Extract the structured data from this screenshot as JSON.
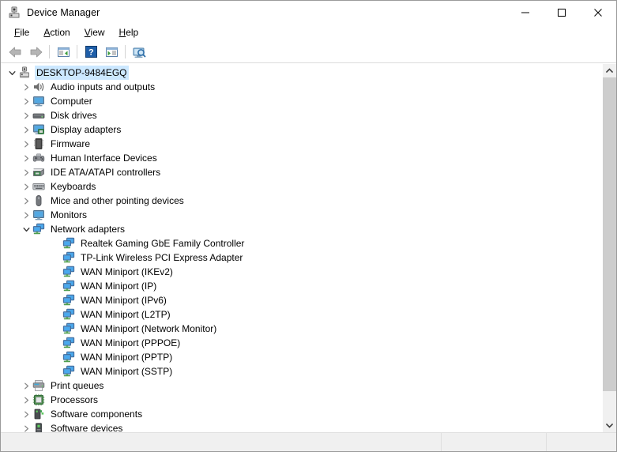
{
  "window": {
    "title": "Device Manager",
    "app_icon": "device-manager-icon",
    "controls": {
      "minimize": "minimize-icon",
      "maximize": "maximize-icon",
      "close": "close-icon"
    }
  },
  "menubar": {
    "items": [
      {
        "label": "File",
        "accel": "F"
      },
      {
        "label": "Action",
        "accel": "A"
      },
      {
        "label": "View",
        "accel": "V"
      },
      {
        "label": "Help",
        "accel": "H"
      }
    ]
  },
  "toolbar": {
    "buttons": [
      {
        "name": "back-button",
        "icon": "back-arrow-icon"
      },
      {
        "name": "forward-button",
        "icon": "forward-arrow-icon"
      },
      {
        "name": "separator-1",
        "icon": "separator"
      },
      {
        "name": "properties-button",
        "icon": "properties-panel-icon"
      },
      {
        "name": "separator-2",
        "icon": "separator"
      },
      {
        "name": "help-button",
        "icon": "help-question-icon"
      },
      {
        "name": "update-driver-button",
        "icon": "update-panel-icon"
      },
      {
        "name": "separator-3",
        "icon": "separator"
      },
      {
        "name": "scan-hardware-button",
        "icon": "scan-monitor-icon"
      }
    ]
  },
  "tree": {
    "root": {
      "label": "DESKTOP-9484EGQ",
      "icon": "computer-root-icon",
      "expanded": true,
      "selected": true
    },
    "nodes": [
      {
        "label": "Audio inputs and outputs",
        "icon": "speaker-icon",
        "level": 1,
        "expanded": false,
        "has_children": true
      },
      {
        "label": "Computer",
        "icon": "monitor-icon",
        "level": 1,
        "expanded": false,
        "has_children": true
      },
      {
        "label": "Disk drives",
        "icon": "disk-drive-icon",
        "level": 1,
        "expanded": false,
        "has_children": true
      },
      {
        "label": "Display adapters",
        "icon": "display-adapter-icon",
        "level": 1,
        "expanded": false,
        "has_children": true
      },
      {
        "label": "Firmware",
        "icon": "firmware-chip-icon",
        "level": 1,
        "expanded": false,
        "has_children": true
      },
      {
        "label": "Human Interface Devices",
        "icon": "gamepad-icon",
        "level": 1,
        "expanded": false,
        "has_children": true
      },
      {
        "label": "IDE ATA/ATAPI controllers",
        "icon": "ide-controller-icon",
        "level": 1,
        "expanded": false,
        "has_children": true
      },
      {
        "label": "Keyboards",
        "icon": "keyboard-icon",
        "level": 1,
        "expanded": false,
        "has_children": true
      },
      {
        "label": "Mice and other pointing devices",
        "icon": "mouse-icon",
        "level": 1,
        "expanded": false,
        "has_children": true
      },
      {
        "label": "Monitors",
        "icon": "monitor-icon",
        "level": 1,
        "expanded": false,
        "has_children": true
      },
      {
        "label": "Network adapters",
        "icon": "network-adapter-icon",
        "level": 1,
        "expanded": true,
        "has_children": true
      },
      {
        "label": "Realtek Gaming GbE Family Controller",
        "icon": "network-adapter-icon",
        "level": 2,
        "expanded": false,
        "has_children": false
      },
      {
        "label": "TP-Link Wireless PCI Express Adapter",
        "icon": "network-adapter-icon",
        "level": 2,
        "expanded": false,
        "has_children": false
      },
      {
        "label": "WAN Miniport (IKEv2)",
        "icon": "network-adapter-icon",
        "level": 2,
        "expanded": false,
        "has_children": false
      },
      {
        "label": "WAN Miniport (IP)",
        "icon": "network-adapter-icon",
        "level": 2,
        "expanded": false,
        "has_children": false
      },
      {
        "label": "WAN Miniport (IPv6)",
        "icon": "network-adapter-icon",
        "level": 2,
        "expanded": false,
        "has_children": false
      },
      {
        "label": "WAN Miniport (L2TP)",
        "icon": "network-adapter-icon",
        "level": 2,
        "expanded": false,
        "has_children": false
      },
      {
        "label": "WAN Miniport (Network Monitor)",
        "icon": "network-adapter-icon",
        "level": 2,
        "expanded": false,
        "has_children": false
      },
      {
        "label": "WAN Miniport (PPPOE)",
        "icon": "network-adapter-icon",
        "level": 2,
        "expanded": false,
        "has_children": false
      },
      {
        "label": "WAN Miniport (PPTP)",
        "icon": "network-adapter-icon",
        "level": 2,
        "expanded": false,
        "has_children": false
      },
      {
        "label": "WAN Miniport (SSTP)",
        "icon": "network-adapter-icon",
        "level": 2,
        "expanded": false,
        "has_children": false
      },
      {
        "label": "Print queues",
        "icon": "printer-icon",
        "level": 1,
        "expanded": false,
        "has_children": true
      },
      {
        "label": "Processors",
        "icon": "processor-icon",
        "level": 1,
        "expanded": false,
        "has_children": true
      },
      {
        "label": "Software components",
        "icon": "software-component-icon",
        "level": 1,
        "expanded": false,
        "has_children": true
      },
      {
        "label": "Software devices",
        "icon": "software-device-icon",
        "level": 1,
        "expanded": false,
        "has_children": true
      }
    ]
  },
  "scrollbar": {
    "up_arrow": "scroll-up-icon",
    "down_arrow": "scroll-down-icon",
    "thumb_top_pct": 0,
    "thumb_height_pct": 92
  },
  "statusbar": {
    "cells": [
      "",
      "",
      ""
    ]
  },
  "colors": {
    "selection": "#cce8ff",
    "chrome": "#f0f0f0",
    "content": "#ffffff",
    "scroll_thumb": "#cdcdcd"
  }
}
